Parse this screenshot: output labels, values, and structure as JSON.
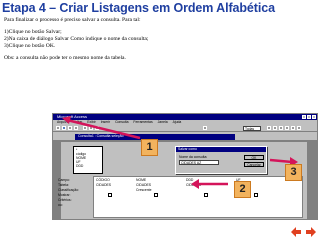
{
  "slide": {
    "title": "Etapa 4 – Criar Listagens em Ordem Alfabética",
    "intro": "Para finalizar o processo é preciso salvar a consulta. Para tal:",
    "steps": [
      "1)Clique no botão Salvar;",
      "2)Na caixa de diálogo Salvar Como indique o nome da consulta;",
      "3)Clique no botão OK."
    ],
    "note": "Obs: a consulta não pode ter o mesmo nome da tabela."
  },
  "screenshot": {
    "window_title": "Microsoft Access",
    "menu": [
      "Arquivo",
      "Editar",
      "Exibir",
      "Inserir",
      "Consulta",
      "Ferramentas",
      "Janela",
      "Ajuda"
    ],
    "toolbar_combo": "Todas",
    "query_window_title": "Consulta1 : Consulta seleção",
    "field_list": [
      "*",
      "código",
      "NOME",
      "UF",
      "DDD"
    ],
    "grid_labels": [
      "Campo:",
      "Tabela:",
      "Classificação:",
      "Mostrar:",
      "Critérios:",
      "ou:"
    ],
    "grid_fields": [
      "CÓDIGO",
      "NOME",
      "DDD",
      "UF"
    ],
    "grid_table": "CIDADES",
    "grid_sort": "Crescente",
    "dialog": {
      "title": "Salvar como",
      "label": "Nome da consulta:",
      "value": "CIDADES AZ",
      "ok": "OK",
      "cancel": "Cancelar"
    }
  },
  "badges": [
    "1",
    "2",
    "3"
  ],
  "colors": {
    "title": "#1f3fa0",
    "badge": "#f2b35e",
    "arrow": "#d4145a",
    "nav": "#e04020"
  },
  "nav_icons": [
    "back-arrow-icon",
    "forward-arrow-icon"
  ]
}
